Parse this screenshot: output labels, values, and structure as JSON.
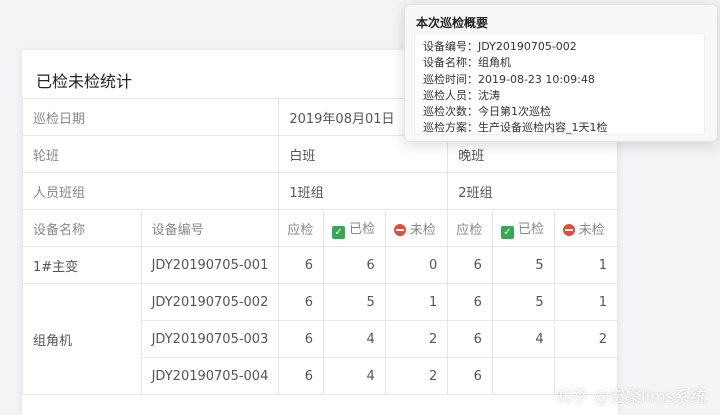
{
  "panel": {
    "title": "已检未检统计"
  },
  "table": {
    "date_label": "巡检日期",
    "date_value": "2019年08月01日",
    "shift_label": "轮班",
    "shift1": "白班",
    "shift2": "晚班",
    "group_label": "人员班组",
    "group1": "1班组",
    "group2": "2班组",
    "col_device_name": "设备名称",
    "col_device_code": "设备编号",
    "col_due": "应检",
    "col_done": "已检",
    "col_undone": "未检",
    "device1_name": "1#主变",
    "device2_name": "组角机",
    "rows": [
      {
        "code": "JDY20190705-001",
        "s1_due": "6",
        "s1_done": "6",
        "s1_undone": "0",
        "s2_due": "6",
        "s2_done": "5",
        "s2_undone": "1"
      },
      {
        "code": "JDY20190705-002",
        "s1_due": "6",
        "s1_done": "5",
        "s1_undone": "1",
        "s2_due": "6",
        "s2_done": "5",
        "s2_undone": "1"
      },
      {
        "code": "JDY20190705-003",
        "s1_due": "6",
        "s1_done": "4",
        "s1_undone": "2",
        "s2_due": "6",
        "s2_done": "4",
        "s2_undone": "2"
      },
      {
        "code": "JDY20190705-004",
        "s1_due": "6",
        "s1_done": "4",
        "s1_undone": "2",
        "s2_due": "6",
        "s2_done": "",
        "s2_undone": ""
      }
    ]
  },
  "popup": {
    "title": "本次巡检概要",
    "lines": [
      "设备编号：JDY20190705-002",
      "设备名称：组角机",
      "巡检时间：2019-08-23 10:09:48",
      "巡检人员：沈涛",
      "巡检次数：今日第1次巡检",
      "巡检方案：生产设备巡检内容_1天1检"
    ]
  },
  "watermark": "知乎 @宏聚lims系统",
  "icons": {
    "done": "check-box-icon",
    "undone": "stop-icon"
  },
  "colors": {
    "done_green": "#3aa757",
    "undone_red": "#e64a3b"
  }
}
